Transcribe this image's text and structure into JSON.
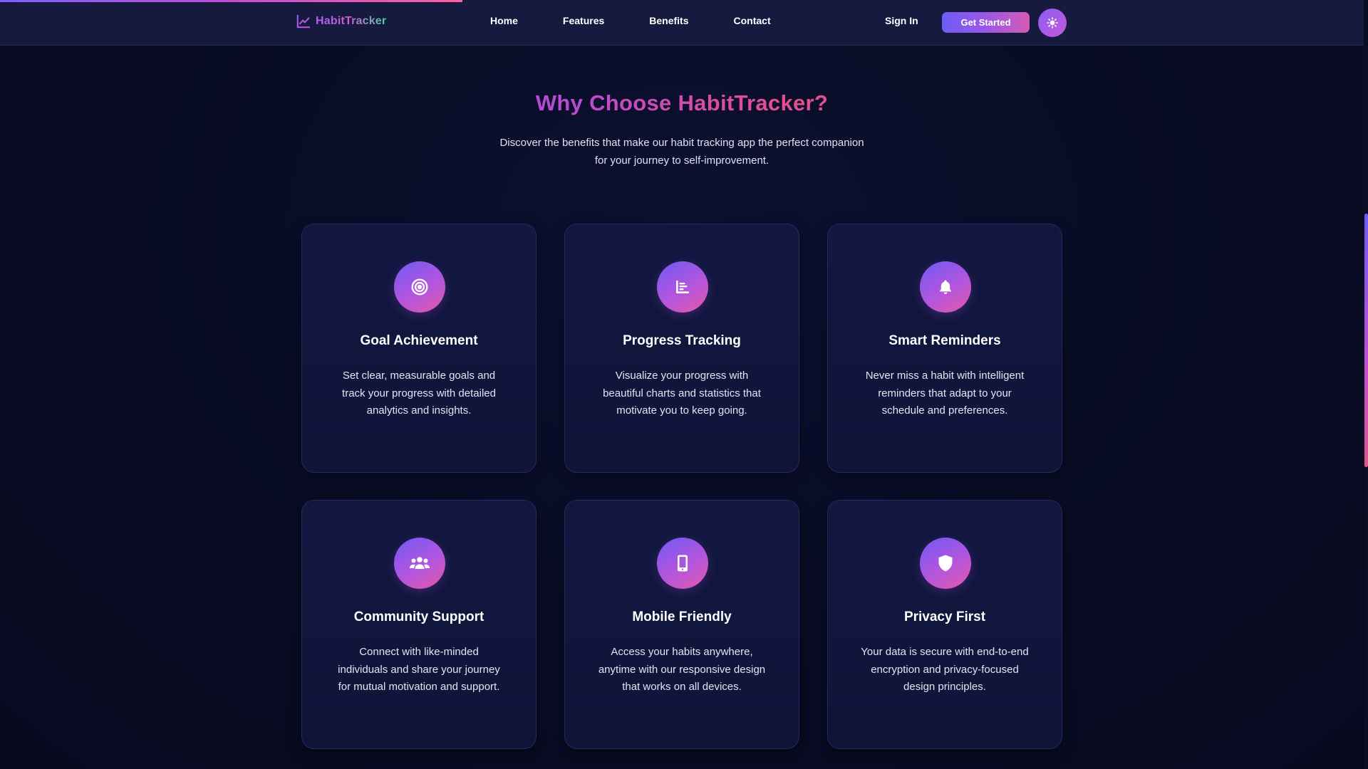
{
  "scroll_progress": 0.338,
  "colors": {
    "accent_purple": "#7b61ff",
    "accent_pink": "#e2508f",
    "background": "#080b22",
    "card": "#121741"
  },
  "navbar": {
    "logo_icon": "trend-chart-icon",
    "logo_text": "HabitTracker",
    "links": [
      "Home",
      "Features",
      "Benefits",
      "Contact"
    ],
    "sign_in": "Sign In",
    "cta": "Get Started",
    "theme_icon": "sun-icon"
  },
  "section": {
    "title": "Why Choose HabitTracker?",
    "subtitle": "Discover the benefits that make our habit tracking app the perfect companion for your journey to self-improvement."
  },
  "benefits": [
    {
      "icon": "target-icon",
      "title": "Goal Achievement",
      "description": "Set clear, measurable goals and track your progress with detailed analytics and insights."
    },
    {
      "icon": "chart-icon",
      "title": "Progress Tracking",
      "description": "Visualize your progress with beautiful charts and statistics that motivate you to keep going."
    },
    {
      "icon": "bell-icon",
      "title": "Smart Reminders",
      "description": "Never miss a habit with intelligent reminders that adapt to your schedule and preferences."
    },
    {
      "icon": "users-icon",
      "title": "Community Support",
      "description": "Connect with like-minded individuals and share your journey for mutual motivation and support."
    },
    {
      "icon": "mobile-icon",
      "title": "Mobile Friendly",
      "description": "Access your habits anywhere, anytime with our responsive design that works on all devices."
    },
    {
      "icon": "shield-icon",
      "title": "Privacy First",
      "description": "Your data is secure with end-to-end encryption and privacy-focused design principles."
    }
  ]
}
